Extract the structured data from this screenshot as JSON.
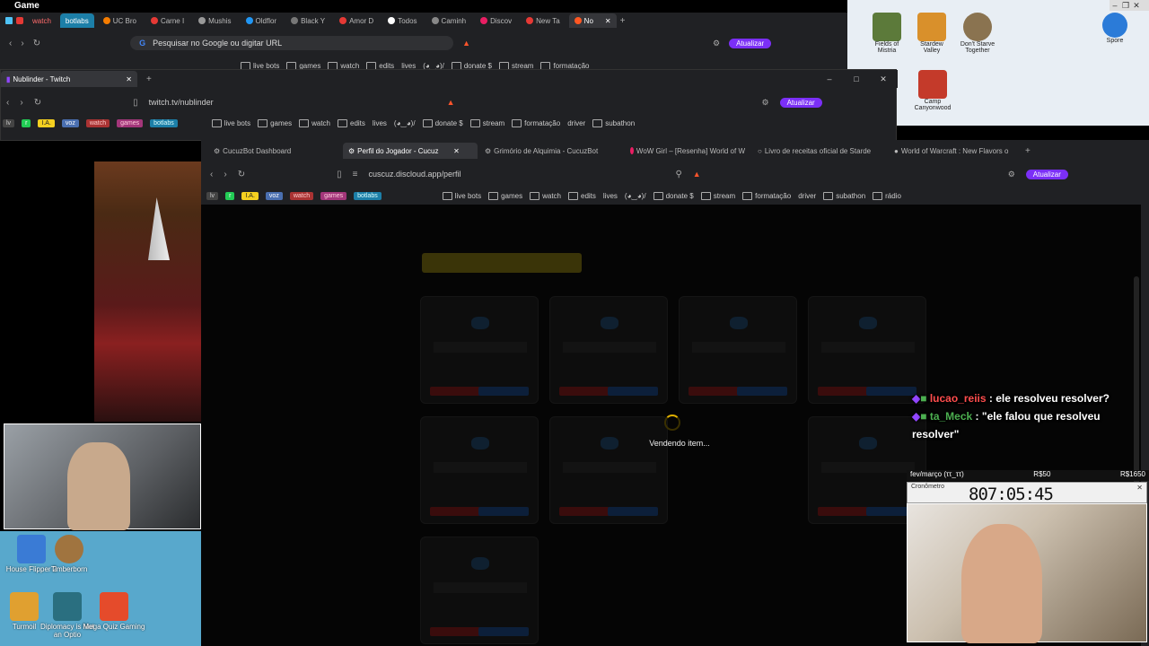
{
  "game_title": "Game",
  "win1": {
    "tabs": [
      {
        "label": "watch",
        "color": "#e53935"
      },
      {
        "label": "botlabs",
        "color": "#1c7fa8"
      },
      {
        "label": "UC Bro",
        "color": "#f57c00"
      },
      {
        "label": "Carne I",
        "color": "#e53935"
      },
      {
        "label": "Mushis",
        "color": "#999999"
      },
      {
        "label": "Oldflor",
        "color": "#2196f3"
      },
      {
        "label": "Black Y",
        "color": "#777777"
      },
      {
        "label": "Amor D",
        "color": "#e53935"
      },
      {
        "label": "Todos",
        "color": "#ffffff"
      },
      {
        "label": "Caminh",
        "color": "#888888"
      },
      {
        "label": "Discov",
        "color": "#e91e63"
      },
      {
        "label": "New Ta",
        "color": "#e53935"
      },
      {
        "label": "No",
        "color": "#ff5722"
      }
    ],
    "address_placeholder": "Pesquisar no Google ou digitar URL",
    "update_label": "Atualizar",
    "bookmarks": [
      "live bots",
      "games",
      "watch",
      "edits",
      "lives",
      "(◕‿◕)/",
      "donate $",
      "stream",
      "formatação"
    ]
  },
  "win2": {
    "tab_title": "Nublinder - Twitch",
    "address": "twitch.tv/nublinder",
    "update_label": "Atualizar",
    "tags": [
      "lv",
      "r",
      "I.A.",
      "voz",
      "watch",
      "games",
      "botlabs"
    ],
    "bookmarks": [
      "live bots",
      "games",
      "watch",
      "edits",
      "lives",
      "(◕‿◕)/",
      "donate $",
      "stream",
      "formatação",
      "driver",
      "subathon"
    ]
  },
  "win3": {
    "tabs": [
      {
        "label": "CucuzBot Dashboard",
        "active": false
      },
      {
        "label": "Perfil do Jogador - Cucuz",
        "active": true
      },
      {
        "label": "Grimório de Alquimia - CucuzBot",
        "active": false
      },
      {
        "label": "WoW Girl – [Resenha] World of W",
        "active": false
      },
      {
        "label": "Livro de receitas oficial de Starde",
        "active": false
      },
      {
        "label": "World of Warcraft : New Flavors o",
        "active": false
      }
    ],
    "address": "cuscuz.discloud.app/perfil",
    "update_label": "Atualizar",
    "tags": [
      "lv",
      "r",
      "I.A.",
      "voz",
      "watch",
      "games",
      "botlabs"
    ],
    "bookmarks": [
      "live bots",
      "games",
      "watch",
      "edits",
      "lives",
      "(◕‿◕)/",
      "donate $",
      "stream",
      "formatação",
      "driver",
      "subathon",
      "rádio"
    ],
    "loading_text": "Vendendo item..."
  },
  "chat": [
    {
      "user": "lucao_reiis",
      "user_color": "#ff4d4d",
      "message": ": ele resolveu resolver?"
    },
    {
      "user": "ta_Meck",
      "user_color": "#4caf50",
      "message": ": \"ele falou que resolveu resolver\""
    }
  ],
  "overlay": {
    "date_label": "fev/março (ττ_ττ)",
    "goal1": "R$50",
    "goal2": "R$1650",
    "timer_window": "Cronômetro",
    "timer": "807:05:45"
  },
  "desktop_top": [
    {
      "label": "Fields of Mistria"
    },
    {
      "label": "Stardew Valley"
    },
    {
      "label": "Don't Starve Together"
    },
    {
      "label": "Spore"
    },
    {
      "label": "Camp Canyonwood"
    }
  ],
  "desktop_bottom": [
    {
      "label": "House Flipper 2"
    },
    {
      "label": "Timberborn"
    },
    {
      "label": "Turmoil"
    },
    {
      "label": "Diplomacy is Not an Optio"
    },
    {
      "label": "Mega Quiz Gaming"
    }
  ]
}
